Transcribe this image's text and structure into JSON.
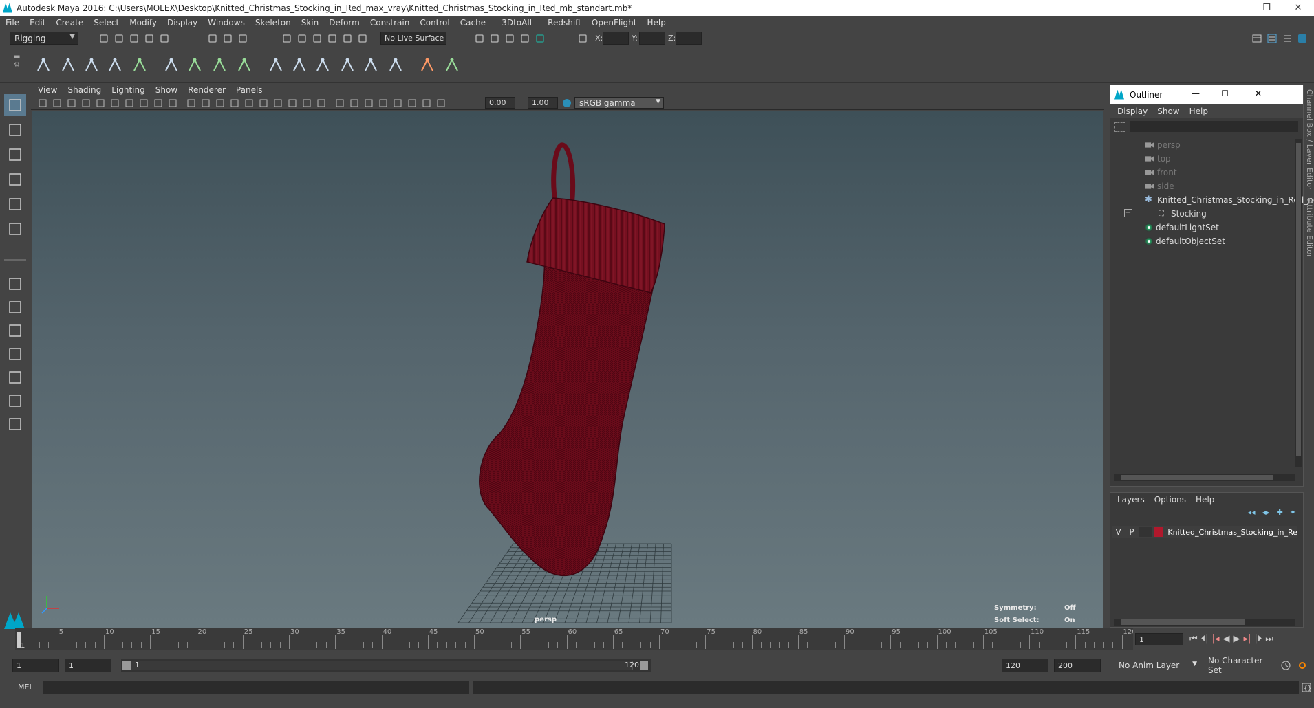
{
  "window": {
    "title": "Autodesk Maya 2016: C:\\Users\\MOLEX\\Desktop\\Knitted_Christmas_Stocking_in_Red_max_vray\\Knitted_Christmas_Stocking_in_Red_mb_standart.mb*",
    "minimize": "—",
    "restore": "❐",
    "close": "✕"
  },
  "menubar": [
    "File",
    "Edit",
    "Create",
    "Select",
    "Modify",
    "Display",
    "Windows",
    "Skeleton",
    "Skin",
    "Deform",
    "Constrain",
    "Control",
    "Cache",
    "- 3DtoAll -",
    "Redshift",
    "OpenFlight",
    "Help"
  ],
  "statusline": {
    "mode": "Rigging",
    "live_surface": "No Live Surface",
    "x_label": "X:",
    "y_label": "Y:",
    "z_label": "Z:"
  },
  "viewport": {
    "menu": [
      "View",
      "Shading",
      "Lighting",
      "Show",
      "Renderer",
      "Panels"
    ],
    "exposure": "0.00",
    "gamma": "1.00",
    "color_space": "sRGB gamma",
    "camera_label": "persp",
    "symmetry_label": "Symmetry:",
    "symmetry_value": "Off",
    "soft_select_label": "Soft Select:",
    "soft_select_value": "On",
    "stocking_color": "#7a0f1e"
  },
  "outliner": {
    "title": "Outliner",
    "menu": [
      "Display",
      "Show",
      "Help"
    ],
    "items": [
      {
        "label": "persp",
        "icon": "camera-icon",
        "dim": true
      },
      {
        "label": "top",
        "icon": "camera-icon",
        "dim": true
      },
      {
        "label": "front",
        "icon": "camera-icon",
        "dim": true
      },
      {
        "label": "side",
        "icon": "camera-icon",
        "dim": true
      },
      {
        "label": "Knitted_Christmas_Stocking_in_Red_ncl",
        "icon": "group-icon",
        "dim": false
      },
      {
        "label": "Stocking",
        "icon": "mesh-icon",
        "dim": false
      },
      {
        "label": "defaultLightSet",
        "icon": "set-icon",
        "dim": false
      },
      {
        "label": "defaultObjectSet",
        "icon": "set-icon",
        "dim": false
      }
    ]
  },
  "layers": {
    "menu": [
      "Layers",
      "Options",
      "Help"
    ],
    "row": {
      "v": "V",
      "p": "P",
      "name": "Knitted_Christmas_Stocking_in_Red",
      "color": "#b0182c"
    }
  },
  "side_tabs": [
    "Channel Box / Layer Editor",
    "Attribute Editor"
  ],
  "timeline": {
    "ticks": [
      5,
      10,
      15,
      20,
      25,
      30,
      35,
      40,
      45,
      50,
      55,
      60,
      65,
      70,
      75,
      80,
      85,
      90,
      95,
      100,
      105,
      110,
      115,
      120
    ],
    "first": "1",
    "current_frame": "1"
  },
  "range": {
    "start": "1",
    "playback_start": "1",
    "slider_start": "1",
    "slider_end": "120",
    "playback_end": "120",
    "end": "200",
    "anim_layer": "No Anim Layer",
    "character_set": "No Character Set"
  },
  "cmdline": {
    "label": "MEL"
  }
}
